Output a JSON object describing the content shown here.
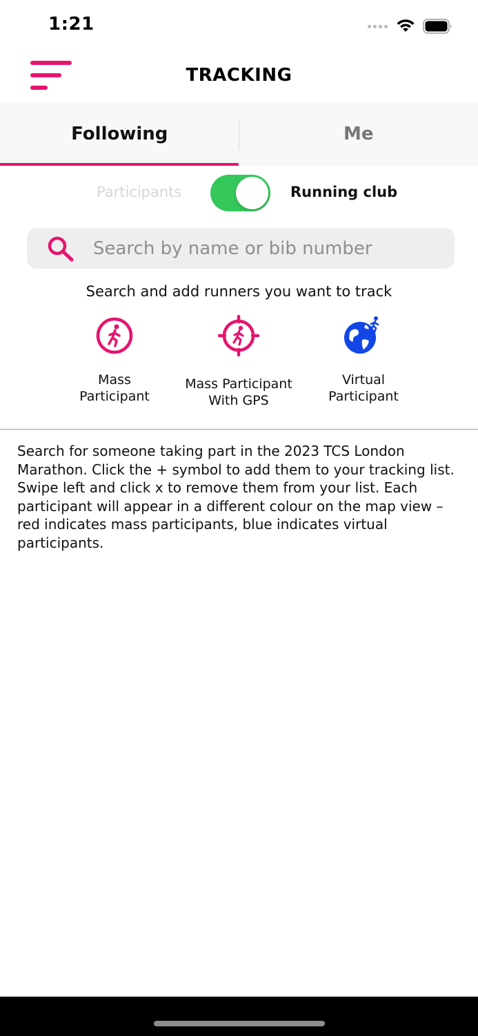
{
  "status_bar": {
    "time": "1:21"
  },
  "header": {
    "title": "TRACKING",
    "menu_icon": "hamburger-menu-icon"
  },
  "tabs": [
    {
      "label": "Following",
      "active": true
    },
    {
      "label": "Me",
      "active": false
    }
  ],
  "toggle": {
    "left_label": "Participants",
    "right_label": "Running club",
    "state": "on"
  },
  "search": {
    "placeholder": "Search by name or bib number",
    "value": "",
    "icon": "search-icon"
  },
  "helper_text": "Search and add runners you want to track",
  "legend": [
    {
      "label": "Mass\nParticipant",
      "icon": "runner-circle-icon"
    },
    {
      "label": "Mass Participant\nWith GPS",
      "icon": "runner-gps-target-icon"
    },
    {
      "label": "Virtual\nParticipant",
      "icon": "runner-globe-icon"
    }
  ],
  "info_text": "Search for someone taking part in the 2023 TCS London Marathon. Click the + symbol to add them to your tracking list. Swipe left and click x to remove them from your list. Each participant will appear in a different colour on the map view – red indicates mass participants, blue indicates virtual participants.",
  "colors": {
    "accent": "#e5146e",
    "toggle_on": "#34c759",
    "virtual_blue": "#1346e6"
  }
}
